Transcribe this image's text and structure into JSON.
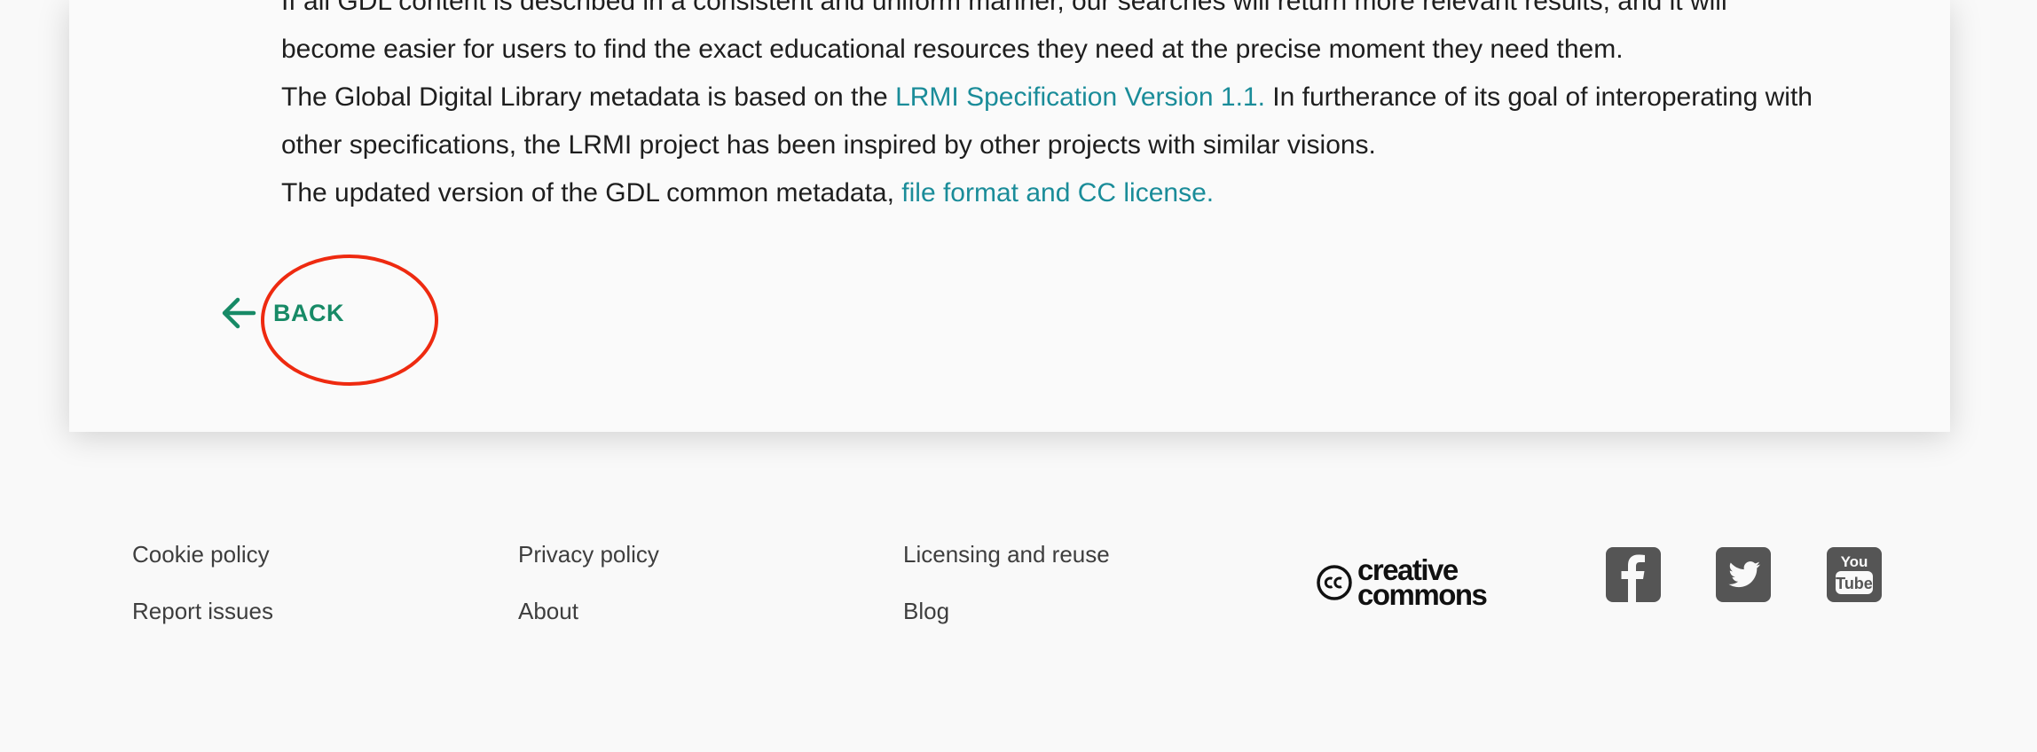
{
  "article": {
    "paragraph1": "If all GDL content is described in a consistent and uniform manner, our searches will return more relevant results, and it will become easier for users to find the exact educational resources they need at the precise moment they need them.",
    "paragraph2_before": "The Global Digital Library metadata is based on the ",
    "paragraph2_link": "LRMI Specification Version 1.1.",
    "paragraph2_after": " In furtherance of its goal of interoperating with other specifications, the LRMI project has been inspired by other projects with similar visions.",
    "paragraph3_before": "The updated version of the GDL common metadata, ",
    "paragraph3_link": "file format and CC license."
  },
  "back_button": {
    "label": "BACK"
  },
  "footer": {
    "links": {
      "cookie_policy": "Cookie policy",
      "report_issues": "Report issues",
      "privacy_policy": "Privacy policy",
      "about": "About",
      "licensing": "Licensing and reuse",
      "blog": "Blog"
    },
    "cc_logo": {
      "line1": "creative",
      "line2": "commons",
      "icon": "cc-icon"
    },
    "social": [
      "facebook-icon",
      "twitter-icon",
      "youtube-icon"
    ]
  },
  "colors": {
    "link": "#1a8c99",
    "back": "#178a66",
    "annotation": "#ee2a10",
    "social_bg": "#555555"
  }
}
